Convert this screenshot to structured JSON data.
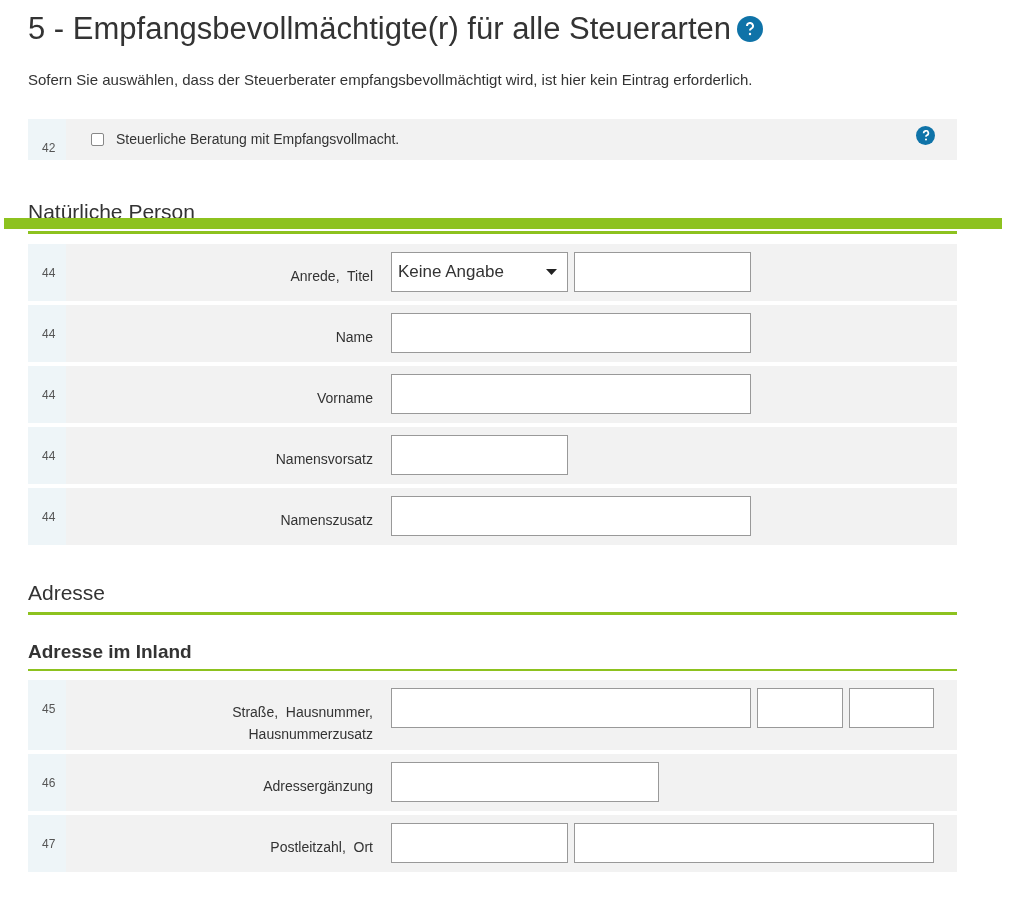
{
  "title": "5 - Empfangsbevollmächtigte(r) für alle Steuerarten",
  "intro": "Sofern Sie auswählen, dass der Steuerberater empfangsbevollmächtigt wird, ist hier kein Eintrag erforderlich.",
  "consent": {
    "number": "42",
    "label": "Steuerliche Beratung mit Empfangsvollmacht.",
    "checked": false
  },
  "sections": [
    {
      "heading": "Natürliche Person",
      "kind": "heading",
      "rows": [
        {
          "number": "44",
          "label": "Anrede,  Titel",
          "fields": [
            {
              "kind": "select",
              "value": "Keine Angabe"
            },
            {
              "kind": "text"
            }
          ]
        },
        {
          "number": "44",
          "label": "Name",
          "fields": [
            {
              "kind": "text"
            }
          ]
        },
        {
          "number": "44",
          "label": "Vorname",
          "fields": [
            {
              "kind": "text"
            }
          ]
        },
        {
          "number": "44",
          "label": "Namensvorsatz",
          "fields": [
            {
              "kind": "text"
            }
          ]
        },
        {
          "number": "44",
          "label": "Namenszusatz",
          "fields": [
            {
              "kind": "text"
            }
          ]
        }
      ]
    },
    {
      "heading": "Adresse",
      "kind": "heading"
    },
    {
      "heading": "Adresse im Inland",
      "kind": "subheading",
      "rows": [
        {
          "number": "45",
          "label": "Straße,  Hausnummer,\nHausnummerzusatz",
          "fields": [
            {
              "kind": "text"
            },
            {
              "kind": "text"
            },
            {
              "kind": "text"
            }
          ]
        },
        {
          "number": "46",
          "label": "Adressergänzung",
          "fields": [
            {
              "kind": "text"
            }
          ]
        },
        {
          "number": "47",
          "label": "Postleitzahl,  Ort",
          "fields": [
            {
              "kind": "text"
            },
            {
              "kind": "text"
            }
          ]
        }
      ]
    }
  ]
}
